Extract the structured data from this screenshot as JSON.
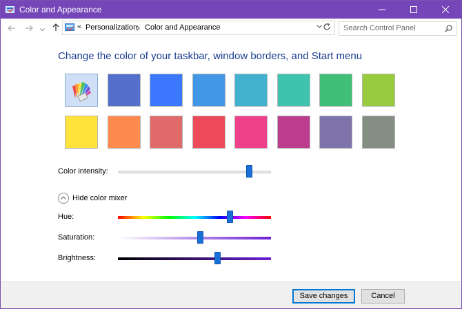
{
  "window": {
    "title": "Color and Appearance",
    "accent_color": "#7446b8"
  },
  "address": {
    "overflow": "«",
    "crumbs": [
      "Personalization",
      "Color and Appearance"
    ],
    "search_placeholder": "Search Control Panel"
  },
  "main": {
    "heading": "Change the color of your taskbar, window borders, and Start menu",
    "swatches_row1": [
      {
        "name": "automatic",
        "color": "#cfe0f6"
      },
      {
        "name": "slate-blue",
        "color": "#5570cc"
      },
      {
        "name": "blue",
        "color": "#3b78ff"
      },
      {
        "name": "sky-blue",
        "color": "#4296e6"
      },
      {
        "name": "teal-blue",
        "color": "#41b1cf"
      },
      {
        "name": "turquoise",
        "color": "#3ec4ae"
      },
      {
        "name": "green",
        "color": "#3fbf77"
      },
      {
        "name": "lime",
        "color": "#99cb3f"
      }
    ],
    "swatches_row2": [
      {
        "name": "yellow",
        "color": "#ffe33b"
      },
      {
        "name": "orange",
        "color": "#ff8a4f"
      },
      {
        "name": "salmon",
        "color": "#e06a6a"
      },
      {
        "name": "red",
        "color": "#ec4a5a"
      },
      {
        "name": "pink",
        "color": "#ef4189"
      },
      {
        "name": "magenta",
        "color": "#bc3c8e"
      },
      {
        "name": "lavender",
        "color": "#7e73aa"
      },
      {
        "name": "gray-green",
        "color": "#848e82"
      }
    ],
    "intensity_label": "Color intensity:",
    "intensity_value": 0.86,
    "mixer_toggle_label": "Hide color mixer",
    "hue_label": "Hue:",
    "hue_value": 0.73,
    "saturation_label": "Saturation:",
    "saturation_value": 0.54,
    "brightness_label": "Brightness:",
    "brightness_value": 0.65
  },
  "footer": {
    "save_label": "Save changes",
    "cancel_label": "Cancel"
  }
}
